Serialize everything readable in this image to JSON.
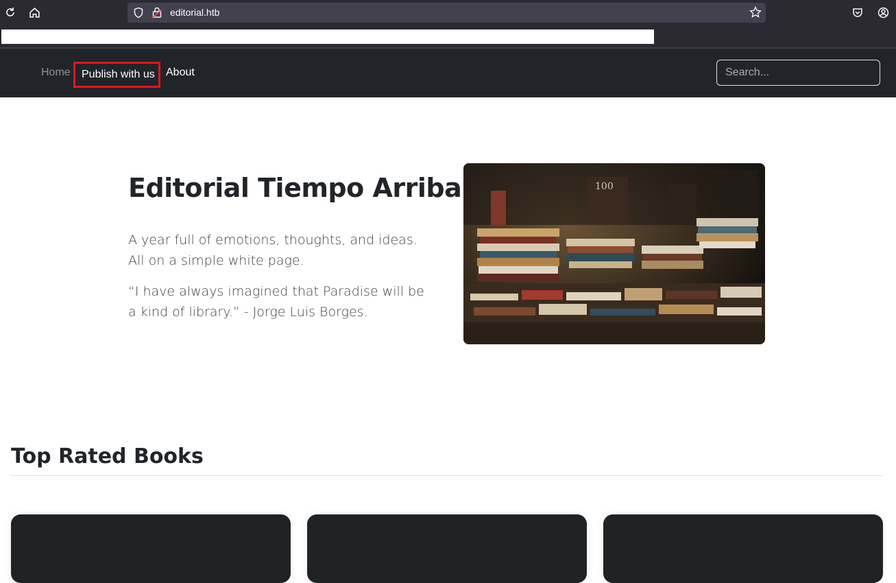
{
  "browser": {
    "url": "editorial.htb",
    "icons": [
      "reload-icon",
      "home-icon",
      "shield-icon",
      "lock-icon",
      "star-icon",
      "pocket-icon",
      "account-icon"
    ]
  },
  "navbar": {
    "items": [
      {
        "label": "Home"
      },
      {
        "label": "Publish with us"
      },
      {
        "label": "About"
      }
    ],
    "search_placeholder": "Search...",
    "highlight_color": "#e3161d"
  },
  "hero": {
    "title": "Editorial Tiempo Arriba",
    "paragraph1": "A year full of emotions, thoughts, and ideas. All on a simple white page.",
    "paragraph2": "“I have always imagined that Paradise will be a kind of library.” - Jorge Luis Borges."
  },
  "top_rated": {
    "title": "Top Rated Books"
  },
  "colors": {
    "navbar_bg": "#212529",
    "card_bg": "#1f2326"
  }
}
